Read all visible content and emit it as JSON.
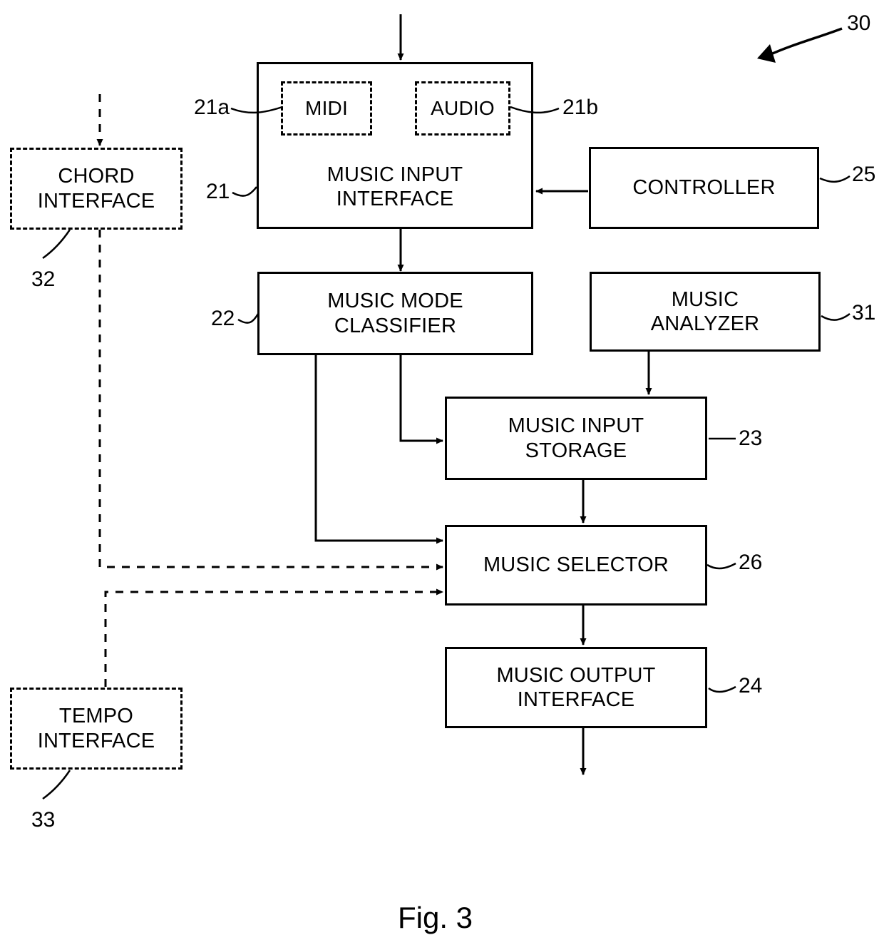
{
  "figure": {
    "caption": "Fig. 3",
    "system_ref": "30"
  },
  "nodes": [
    {
      "id": "music-input-interface",
      "label": "MUSIC INPUT\nINTERFACE",
      "ref": "21",
      "style": "solid"
    },
    {
      "id": "midi",
      "label": "MIDI",
      "ref": "21a",
      "style": "dashed"
    },
    {
      "id": "audio",
      "label": "AUDIO",
      "ref": "21b",
      "style": "dashed"
    },
    {
      "id": "controller",
      "label": "CONTROLLER",
      "ref": "25",
      "style": "solid"
    },
    {
      "id": "music-mode-classifier",
      "label": "MUSIC MODE\nCLASSIFIER",
      "ref": "22",
      "style": "solid"
    },
    {
      "id": "music-analyzer",
      "label": "MUSIC\nANALYZER",
      "ref": "31",
      "style": "solid"
    },
    {
      "id": "music-input-storage",
      "label": "MUSIC INPUT\nSTORAGE",
      "ref": "23",
      "style": "solid"
    },
    {
      "id": "music-selector",
      "label": "MUSIC SELECTOR",
      "ref": "26",
      "style": "solid"
    },
    {
      "id": "music-output-interface",
      "label": "MUSIC OUTPUT\nINTERFACE",
      "ref": "24",
      "style": "solid"
    },
    {
      "id": "chord-interface",
      "label": "CHORD\nINTERFACE",
      "ref": "32",
      "style": "dashed"
    },
    {
      "id": "tempo-interface",
      "label": "TEMPO\nINTERFACE",
      "ref": "33",
      "style": "dashed"
    }
  ],
  "labels": {
    "music_input_interface": "MUSIC INPUT\nINTERFACE",
    "midi": "MIDI",
    "audio": "AUDIO",
    "controller": "CONTROLLER",
    "music_mode_classifier": "MUSIC MODE\nCLASSIFIER",
    "music_analyzer": "MUSIC\nANALYZER",
    "music_input_storage": "MUSIC INPUT\nSTORAGE",
    "music_selector": "MUSIC SELECTOR",
    "music_output_interface": "MUSIC OUTPUT\nINTERFACE",
    "chord_interface": "CHORD\nINTERFACE",
    "tempo_interface": "TEMPO\nINTERFACE"
  },
  "refs": {
    "system": "30",
    "music_input_interface": "21",
    "midi": "21a",
    "audio": "21b",
    "controller": "25",
    "music_mode_classifier": "22",
    "music_analyzer": "31",
    "music_input_storage": "23",
    "music_selector": "26",
    "music_output_interface": "24",
    "chord_interface": "32",
    "tempo_interface": "33"
  },
  "colors": {
    "stroke": "#000000",
    "background": "#ffffff"
  }
}
